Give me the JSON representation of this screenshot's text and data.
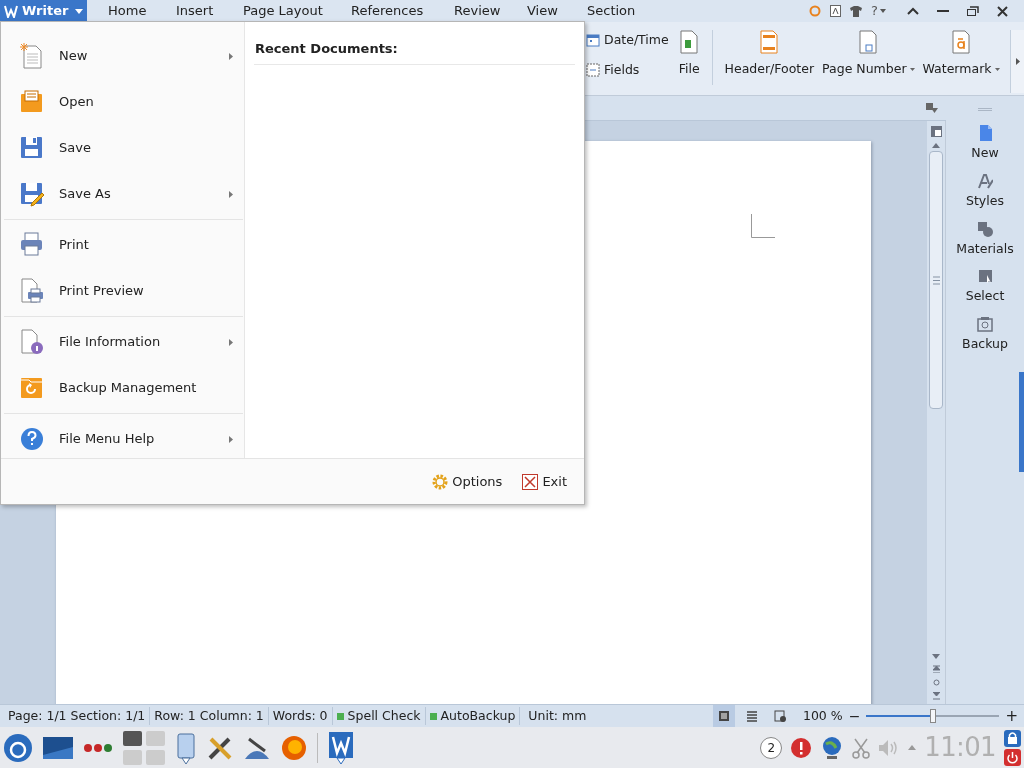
{
  "app_button": {
    "label": "Writer"
  },
  "menu_tabs": [
    {
      "label": "Home",
      "selected": false
    },
    {
      "label": "Insert",
      "selected": false
    },
    {
      "label": "Page Layout",
      "selected": false
    },
    {
      "label": "References",
      "selected": false
    },
    {
      "label": "Review",
      "selected": false
    },
    {
      "label": "View",
      "selected": false
    },
    {
      "label": "Section",
      "selected": false
    }
  ],
  "help_button": {
    "label": "?"
  },
  "ribbon": [
    {
      "kind": "small",
      "items": [
        {
          "label": "Date/Time"
        },
        {
          "label": "Fields"
        }
      ]
    },
    {
      "kind": "large",
      "label": "File",
      "dropdown": false
    },
    {
      "kind": "sep"
    },
    {
      "kind": "large",
      "label": "Header/Footer",
      "dropdown": false
    },
    {
      "kind": "large",
      "label": "Page Number",
      "dropdown": true
    },
    {
      "kind": "large",
      "label": "Watermark",
      "dropdown": true
    }
  ],
  "file_menu": {
    "items": [
      {
        "label": "New",
        "submenu": true
      },
      {
        "label": "Open",
        "submenu": false
      },
      {
        "label": "Save",
        "submenu": false
      },
      {
        "label": "Save As",
        "submenu": true
      },
      {
        "label": "Print",
        "submenu": false
      },
      {
        "label": "Print Preview",
        "submenu": false
      },
      {
        "label": "File Information",
        "submenu": true
      },
      {
        "label": "Backup Management",
        "submenu": false
      },
      {
        "label": "File Menu Help",
        "submenu": true
      }
    ],
    "recent_title": "Recent Documents:",
    "options": "Options",
    "exit": "Exit"
  },
  "side_panel": [
    {
      "label": "New"
    },
    {
      "label": "Styles"
    },
    {
      "label": "Materials"
    },
    {
      "label": "Select"
    },
    {
      "label": "Backup"
    }
  ],
  "status_bar": {
    "fields": [
      {
        "kind": "text",
        "label": "Page: 1/1"
      },
      {
        "kind": "text",
        "label": "Section: 1/1"
      },
      {
        "kind": "text",
        "label": "Row: 1"
      },
      {
        "kind": "text",
        "label": "Column: 1"
      },
      {
        "kind": "text",
        "label": "Words: 0"
      },
      {
        "kind": "toggle",
        "label": "Spell Check",
        "on": true
      },
      {
        "kind": "toggle",
        "label": "AutoBackup",
        "on": true
      },
      {
        "kind": "text",
        "label": "Unit: mm"
      }
    ],
    "views": [
      {
        "selected": true
      },
      {
        "selected": false
      },
      {
        "selected": false
      }
    ],
    "zoom": "100 %",
    "zoom_minus": "−",
    "zoom_plus": "+",
    "zoom_level": {
      "level": 0.5
    }
  },
  "taskbar": {
    "badge": "2",
    "clock": "11:01"
  }
}
